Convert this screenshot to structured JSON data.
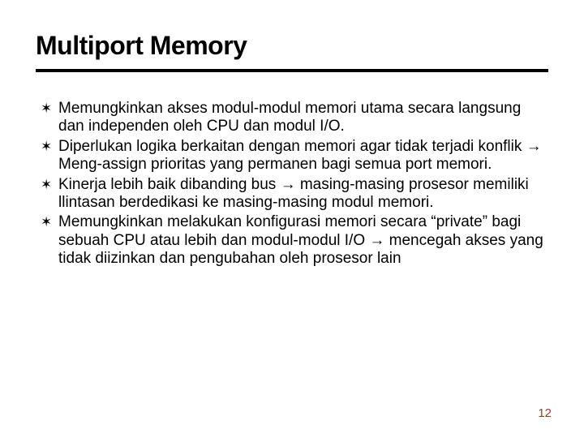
{
  "title": "Multiport Memory",
  "bullets": [
    "Memungkinkan akses modul-modul memori utama secara langsung dan independen oleh CPU dan modul I/O.",
    "Diperlukan logika berkaitan dengan memori agar tidak terjadi konflik → Meng-assign prioritas yang permanen bagi semua port memori.",
    "Kinerja lebih baik dibanding bus → masing-masing prosesor memiliki llintasan berdedikasi ke masing-masing modul memori.",
    "Memungkinkan melakukan konfigurasi memori secara “private” bagi sebuah CPU atau lebih dan modul-modul I/O → mencegah akses yang tidak diizinkan dan pengubahan oleh prosesor lain"
  ],
  "page_number": "12",
  "bullet_glyph": "✶"
}
